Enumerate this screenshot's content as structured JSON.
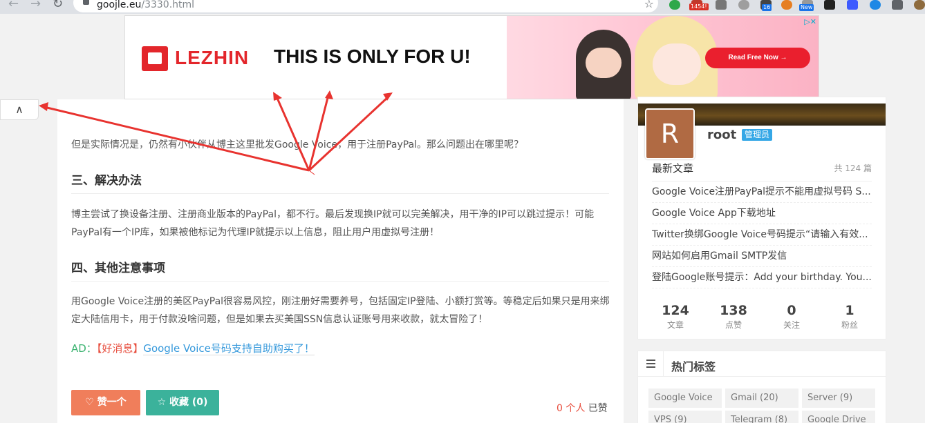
{
  "browser": {
    "url_domain": "goojle.eu",
    "url_path": "/3330.html",
    "badges": [
      "1454!",
      "16",
      "New"
    ]
  },
  "ad": {
    "brand": "LEZHIN",
    "slogan": "THIS IS ONLY FOR U!",
    "cta": "Read Free Now →",
    "choice": "▷✕"
  },
  "collapse_glyph": "∧",
  "article": {
    "p1": "但是实际情况是，仍然有小伙伴从博主这里批发Google Voice，用于注册PayPal。那么问题出在哪里呢？",
    "h3": "三、解决办法",
    "p2": "博主尝试了换设备注册、注册商业版本的PayPal，都不行。最后发现换IP就可以完美解决，用干净的IP可以跳过提示！可能PayPal有一个IP库，如果被他标记为代理IP就提示以上信息，阻止用户用虚拟号注册！",
    "h4": "四、其他注意事项",
    "p3": "用Google Voice注册的美区PayPal很容易风控，刚注册好需要养号，包括固定IP登陆、小额打赏等。等稳定后如果只是用来绑定大陆信用卡，用于付款没啥问题，但是如果去买美国SSN信息认证账号用来收款，就太冒险了！",
    "ad_prefix": "AD：",
    "ad_hot": "【好消息】",
    "ad_link": "Google Voice号码支持自助购买了！",
    "like_button": "♡ 赞一个",
    "fav_button": "☆ 收藏 (0)",
    "likes_count": "0 个人",
    "likes_suffix": " 已赞"
  },
  "sidebar": {
    "avatar_letter": "R",
    "username": "root",
    "role": "管理员",
    "latest_title": "最新文章",
    "latest_count": "共 124 篇",
    "latest_posts": [
      "Google Voice注册PayPal提示不能用虚拟号码 S...",
      "Google Voice App下载地址",
      "Twitter换绑Google Voice号码提示“请输入有效...",
      "网站如何启用Gmail SMTP发信",
      "登陆Google账号提示：Add your birthday. You..."
    ],
    "stats": [
      {
        "num": "124",
        "label": "文章"
      },
      {
        "num": "138",
        "label": "点赞"
      },
      {
        "num": "0",
        "label": "关注"
      },
      {
        "num": "1",
        "label": "粉丝"
      }
    ],
    "tags_title": "热门标签",
    "tags": [
      "Google Voice",
      "Gmail (20)",
      "Server (9)",
      "VPS (9)",
      "Telegram (8)",
      "Google Drive"
    ]
  },
  "colors": {
    "like": "#f07e5b",
    "fav": "#3bb29b",
    "arrow": "#e8332f",
    "role_badge": "#35a7e6"
  }
}
